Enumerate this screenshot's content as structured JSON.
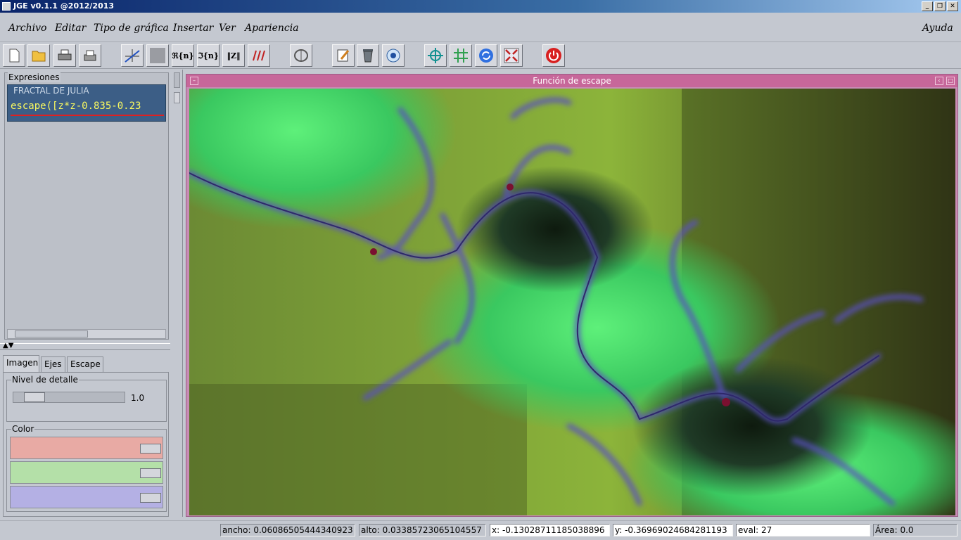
{
  "window": {
    "title": "JGE v0.1.1  @2012/2013"
  },
  "menu": {
    "items": [
      "Archivo",
      "Editar",
      "Tipo de gráfica",
      "Insertar",
      "Ver",
      "Apariencia"
    ],
    "help": "Ayuda"
  },
  "toolbar": {
    "buttons": [
      {
        "name": "new-file-icon",
        "glyph": ""
      },
      {
        "name": "open-folder-icon",
        "glyph": ""
      },
      {
        "name": "print-icon",
        "glyph": ""
      },
      {
        "name": "print-preview-icon",
        "glyph": ""
      },
      {
        "name": "cartesian-plot-icon",
        "glyph": ""
      },
      {
        "name": "grayed-plot-icon",
        "glyph": ""
      },
      {
        "name": "real-sequence-icon",
        "glyph": "ℜ{n}"
      },
      {
        "name": "imaginary-sequence-icon",
        "glyph": "ℑ{n}"
      },
      {
        "name": "modulus-icon",
        "glyph": "‖Z‖"
      },
      {
        "name": "vector-field-icon",
        "glyph": ""
      },
      {
        "name": "complex-plane-icon",
        "glyph": ""
      },
      {
        "name": "edit-icon",
        "glyph": ""
      },
      {
        "name": "delete-icon",
        "glyph": ""
      },
      {
        "name": "view-icon",
        "glyph": ""
      },
      {
        "name": "crosshair-icon",
        "glyph": ""
      },
      {
        "name": "grid-icon",
        "glyph": ""
      },
      {
        "name": "refresh-icon",
        "glyph": ""
      },
      {
        "name": "zoom-fit-icon",
        "glyph": ""
      },
      {
        "name": "power-icon",
        "glyph": ""
      }
    ]
  },
  "expressions": {
    "label": "Expresiones",
    "item_title": "FRACTAL DE JULIA",
    "item_formula": "escape([z*z-0.835-0.23"
  },
  "tabs": [
    "Imagen",
    "Ejes",
    "Escape"
  ],
  "detail": {
    "label": "Nivel de detalle",
    "value": "1.0",
    "level": 0.12
  },
  "color": {
    "label": "Color",
    "bars": [
      "#e8aaa4",
      "#b4e0a8",
      "#b4b0e4"
    ]
  },
  "graph_window": {
    "title": "Función de escape"
  },
  "status": {
    "ancho": "ancho: 0.06086505444340923",
    "alto": "alto: 0.03385723065104557",
    "x": "x: -0.13028711185038896",
    "y": "y: -0.36969024684281193",
    "eval": "eval: 27",
    "area": "Área: 0.0"
  }
}
